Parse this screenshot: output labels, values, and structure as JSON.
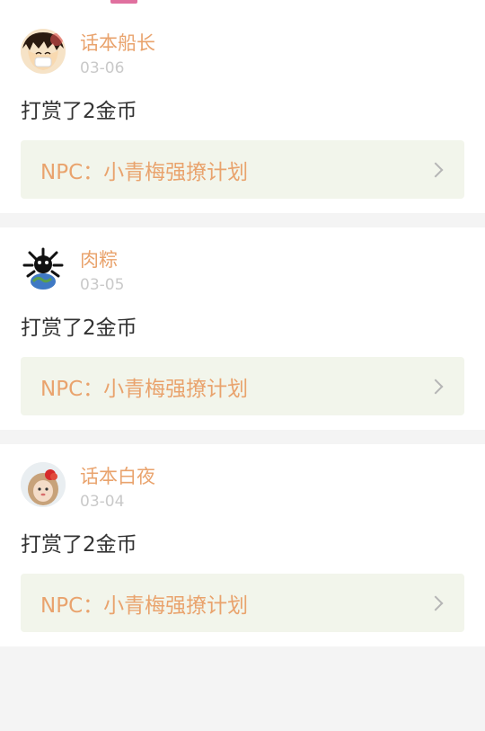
{
  "feed": {
    "items": [
      {
        "user": "话本船长",
        "date": "03-06",
        "action": "打赏了2金币",
        "story": "NPC：小青梅强撩计划",
        "avatar_icon": "luffy-avatar-icon"
      },
      {
        "user": "肉粽",
        "date": "03-05",
        "action": "打赏了2金币",
        "story": "NPC：小青梅强撩计划",
        "avatar_icon": "earth-virus-avatar-icon"
      },
      {
        "user": "话本白夜",
        "date": "03-04",
        "action": "打赏了2金币",
        "story": "NPC：小青梅强撩计划",
        "avatar_icon": "doll-avatar-icon"
      }
    ]
  },
  "colors": {
    "username": "#e9a36d",
    "date": "#c9c9c9",
    "story_bg": "#f2f5eb",
    "indicator": "#e0709f"
  }
}
